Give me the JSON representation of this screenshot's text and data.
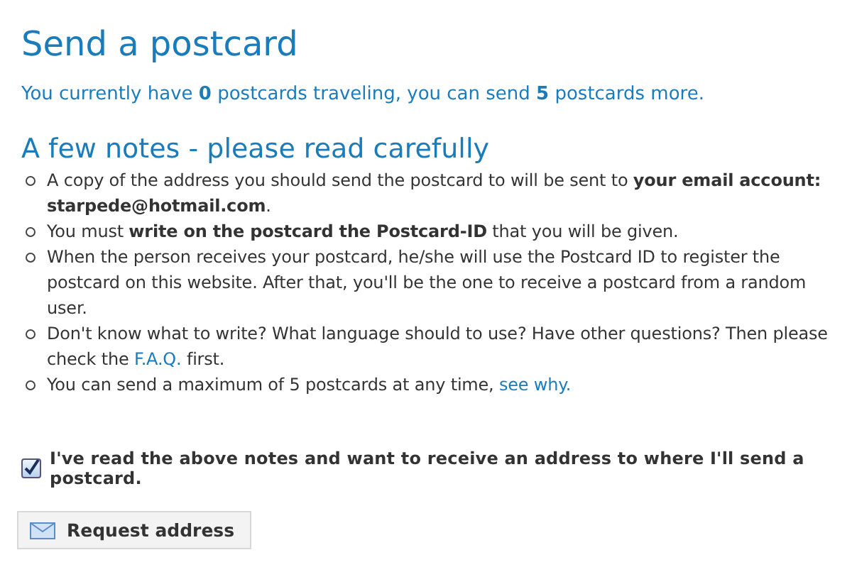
{
  "title": "Send a postcard",
  "status": "You currently have **0** postcards traveling, you can send **5** postcards more.",
  "notes_heading": "A few notes - please read carefully",
  "notes": [
    {
      "text": "A copy of the address you should send the postcard to will be sent to **your email account: starpede@hotmail.com**."
    },
    {
      "text": "You must **write on the postcard the Postcard-ID** that you will be given."
    },
    {
      "text": "When the person receives your postcard, he/she will use the Postcard ID to register the postcard on this website. After that, you'll be the one to receive a postcard from a random user."
    },
    {
      "text": "Don't know what to write? What language should to use? Have other questions? Then please check the ",
      "link": "F.A.Q.",
      "after": " first."
    },
    {
      "text": "You can send a maximum of 5 postcards at any time, ",
      "link": "see why."
    }
  ],
  "agreement": {
    "label": "I've read the above notes and want to receive an address to where I'll send a postcard.",
    "checked": true
  },
  "button": "Request address"
}
